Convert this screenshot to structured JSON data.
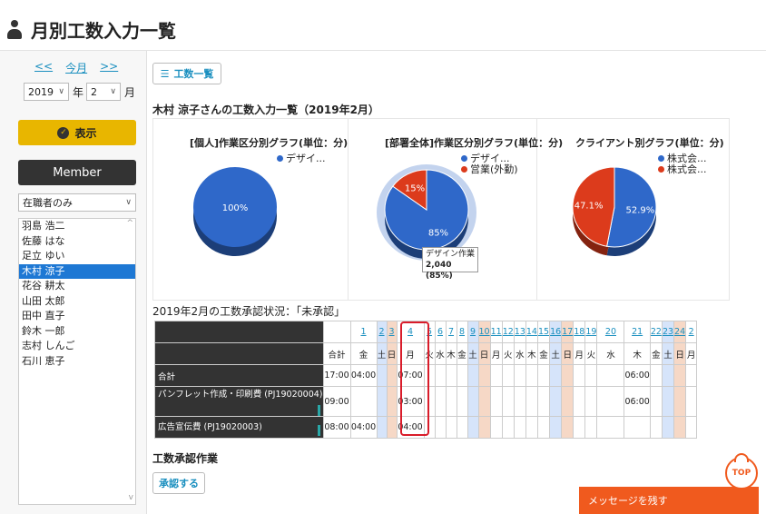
{
  "page": {
    "title": "月別工数入力一覧"
  },
  "sidebar": {
    "nav": {
      "prev": "<<",
      "current": "今月",
      "next": ">>"
    },
    "year": "2019",
    "year_unit": "年",
    "month": "2",
    "month_unit": "月",
    "show_button": "表示",
    "member_button": "Member",
    "filter": "在職者のみ",
    "members": [
      "羽島 浩二",
      "佐藤 はな",
      "足立 ゆい",
      "木村 涼子",
      "花谷 耕太",
      "山田 太郎",
      "田中 直子",
      "鈴木 一郎",
      "志村 しんご",
      "石川 恵子"
    ],
    "selected_member": "木村 涼子"
  },
  "main": {
    "list_button": "工数一覧",
    "section_title": "木村 涼子さんの工数入力一覧（2019年2月）",
    "approval_status": "2019年2月の工数承認状況：「未承認」",
    "approval_section": "工数承認作業",
    "approve_button": "承認する",
    "message_bar": "メッセージを残す",
    "top_button": "TOP"
  },
  "chart_data": [
    {
      "type": "pie",
      "title": "[個人]作業区分別グラフ(単位：分)",
      "legend": [
        "デザイ..."
      ],
      "slices": [
        {
          "name": "デザイ...",
          "value": 100,
          "label": "100%",
          "color": "#2f68c9"
        }
      ]
    },
    {
      "type": "pie",
      "title": "[部署全体]作業区分別グラフ(単位：分)",
      "legend": [
        "デザイ...",
        "営業(外勤)"
      ],
      "slices": [
        {
          "name": "デザイン作業",
          "value": 85,
          "label": "85%",
          "color": "#2f68c9"
        },
        {
          "name": "営業(外勤)",
          "value": 15,
          "label": "15%",
          "color": "#dc3b1c"
        }
      ],
      "tooltip": {
        "name": "デザイン作業",
        "value": "2,040 (85%)"
      }
    },
    {
      "type": "pie",
      "title": "クライアント別グラフ(単位：分)",
      "legend": [
        "株式会...",
        "株式会..."
      ],
      "slices": [
        {
          "name": "株式会...",
          "value": 52.9,
          "label": "52.9%",
          "color": "#2f68c9"
        },
        {
          "name": "株式会...",
          "value": 47.1,
          "label": "47.1%",
          "color": "#dc3b1c"
        }
      ]
    }
  ],
  "grid": {
    "total_label": "合計",
    "head_days": [
      "",
      "1",
      "2",
      "3",
      "4",
      "5",
      "6",
      "7",
      "8",
      "9",
      "10",
      "11",
      "12",
      "13",
      "14",
      "15",
      "16",
      "17",
      "18",
      "19",
      "20",
      "21",
      "22",
      "23",
      "24",
      "2"
    ],
    "head_weekdays": [
      "合計",
      "金",
      "土",
      "日",
      "月",
      "火",
      "水",
      "木",
      "金",
      "土",
      "日",
      "月",
      "火",
      "水",
      "木",
      "金",
      "土",
      "日",
      "月",
      "火",
      "水",
      "木",
      "金",
      "土",
      "日",
      "月"
    ],
    "rows": [
      {
        "label": "合計",
        "cells": [
          "17:00",
          "04:00",
          "",
          "",
          "07:00",
          "",
          "",
          "",
          "",
          "",
          "",
          "",
          "",
          "",
          "",
          "",
          "",
          "",
          "",
          "",
          "",
          "06:00",
          "",
          "",
          "",
          ""
        ]
      },
      {
        "label": "パンフレット作成・印刷費 (PJ19020004)",
        "cells": [
          "09:00",
          "",
          "",
          "",
          "03:00",
          "",
          "",
          "",
          "",
          "",
          "",
          "",
          "",
          "",
          "",
          "",
          "",
          "",
          "",
          "",
          "",
          "06:00",
          "",
          "",
          "",
          ""
        ]
      },
      {
        "label": "広告宣伝費 (PJ19020003)",
        "cells": [
          "08:00",
          "04:00",
          "",
          "",
          "04:00",
          "",
          "",
          "",
          "",
          "",
          "",
          "",
          "",
          "",
          "",
          "",
          "",
          "",
          "",
          "",
          "",
          "",
          "",
          "",
          "",
          ""
        ]
      }
    ]
  }
}
